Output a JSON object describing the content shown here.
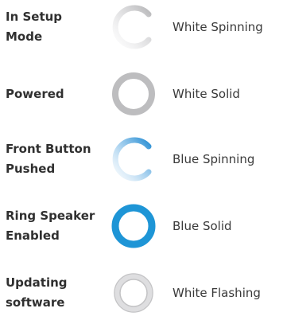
{
  "rows": [
    {
      "state_line1": "In Setup",
      "state_line2": "Mode",
      "light": "White Spinning",
      "icon": "white-spinning-ring-icon",
      "style": "spin",
      "color": "#bdbdbf"
    },
    {
      "state_line1": "Powered",
      "state_line2": "",
      "light": "White Solid",
      "icon": "white-solid-ring-icon",
      "style": "solid",
      "color": "#bdbdbf"
    },
    {
      "state_line1": "Front Button",
      "state_line2": "Pushed",
      "light": "Blue Spinning",
      "icon": "blue-spinning-ring-icon",
      "style": "spin",
      "color": "#2a8fd4"
    },
    {
      "state_line1": "Ring Speaker",
      "state_line2": "Enabled",
      "light": "Blue Solid",
      "icon": "blue-solid-ring-icon",
      "style": "solid",
      "color": "#1e95d6"
    },
    {
      "state_line1": "Updating",
      "state_line2": "software",
      "light": "White Flashing",
      "icon": "white-flashing-ring-icon",
      "style": "flash",
      "color": "#c3c3c5"
    }
  ]
}
